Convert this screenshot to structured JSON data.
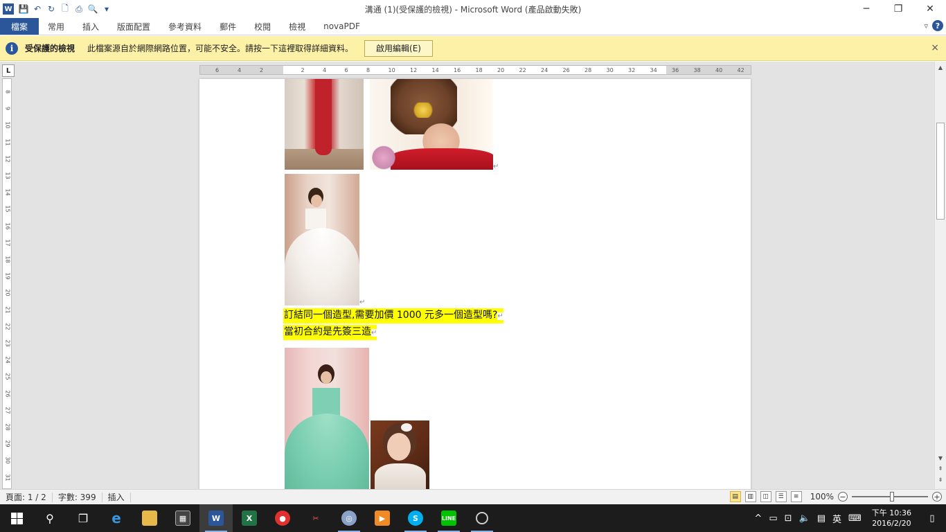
{
  "window": {
    "title": "溝通 (1)(受保護的檢視) - Microsoft Word (產品啟動失敗)",
    "app_icon": "W"
  },
  "ribbon": {
    "tabs": [
      {
        "label": "檔案"
      },
      {
        "label": "常用"
      },
      {
        "label": "插入"
      },
      {
        "label": "版面配置"
      },
      {
        "label": "參考資料"
      },
      {
        "label": "郵件"
      },
      {
        "label": "校閱"
      },
      {
        "label": "檢視"
      },
      {
        "label": "novaPDF"
      }
    ],
    "help": "?"
  },
  "protected_view": {
    "title": "受保護的檢視",
    "message": "此檔案源自於網際網路位置，可能不安全。請按一下這裡取得詳細資料。",
    "button": "啟用編輯(E)",
    "close": "×"
  },
  "ruler": {
    "corner": "L",
    "h_ticks": [
      "6",
      "4",
      "2",
      "2",
      "4",
      "6",
      "8",
      "10",
      "12",
      "14",
      "16",
      "18",
      "20",
      "22",
      "24",
      "26",
      "28",
      "30",
      "32",
      "34",
      "36",
      "38",
      "40",
      "42"
    ],
    "v_ticks": [
      "8",
      "9",
      "10",
      "11",
      "12",
      "13",
      "14",
      "15",
      "16",
      "17",
      "18",
      "19",
      "20",
      "21",
      "22",
      "23",
      "24",
      "25",
      "26",
      "27",
      "28",
      "29",
      "30",
      "31"
    ]
  },
  "document": {
    "line1": "訂結同一個造型,需要加價 1000 元多一個造型嗎?",
    "line2": "當初合約是先簽三造",
    "para_mark": "↵"
  },
  "status": {
    "page": "頁面: 1 / 2",
    "words": "字數: 399",
    "mode": "插入",
    "zoom": "100%"
  },
  "taskbar": {
    "ime": "英",
    "time": "下午 10:36",
    "date": "2016/2/20"
  },
  "colors": {
    "word_blue": "#2b579a",
    "highlight": "#ffff00",
    "pv_bar": "#fdf1a8"
  }
}
